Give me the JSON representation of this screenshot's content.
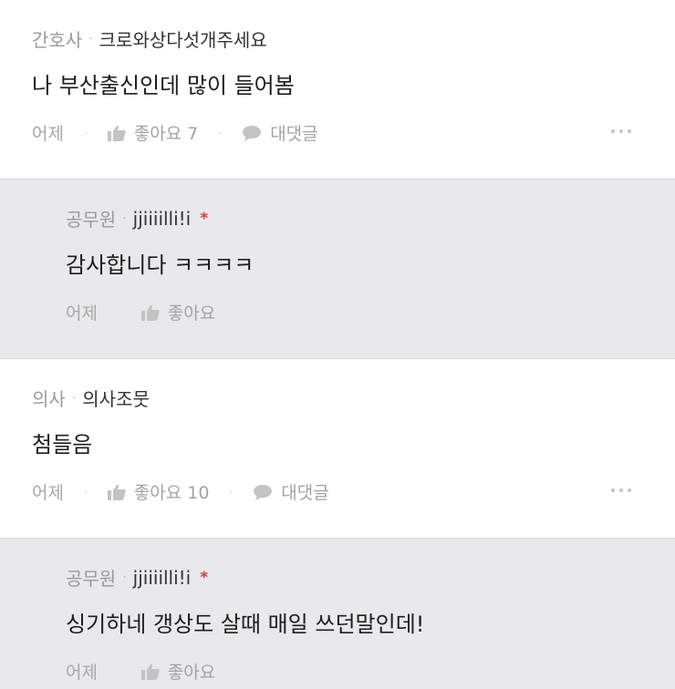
{
  "comments": [
    {
      "type": "comment",
      "job": "간호사",
      "nickname": "크로와상다섯개주세요",
      "text": "나 부산출신인데 많이 들어봄",
      "time": "어제",
      "like_label": "좋아요 7",
      "reply_label": "대댓글"
    },
    {
      "type": "reply",
      "job": "공무원",
      "nickname": "jjiiiilli!i",
      "author_mark": "*",
      "text": "감사합니다 ㅋㅋㅋㅋ",
      "time": "어제",
      "like_label": "좋아요"
    },
    {
      "type": "comment",
      "job": "의사",
      "nickname": "의사조뭇",
      "text": "첨들음",
      "time": "어제",
      "like_label": "좋아요 10",
      "reply_label": "대댓글"
    },
    {
      "type": "reply",
      "job": "공무원",
      "nickname": "jjiiiilli!i",
      "author_mark": "*",
      "text": "싱기하네 갱상도 살때 매일 쓰던말인데!",
      "time": "어제",
      "like_label": "좋아요"
    }
  ],
  "separator": "·",
  "icons": {
    "like": "thumbs-up-icon",
    "reply": "speech-bubble-icon",
    "more": "more-dots-icon"
  },
  "colors": {
    "reply_background": "#e9e9ec",
    "author_mark": "#e8353b",
    "muted_text": "#a3a3a3"
  }
}
